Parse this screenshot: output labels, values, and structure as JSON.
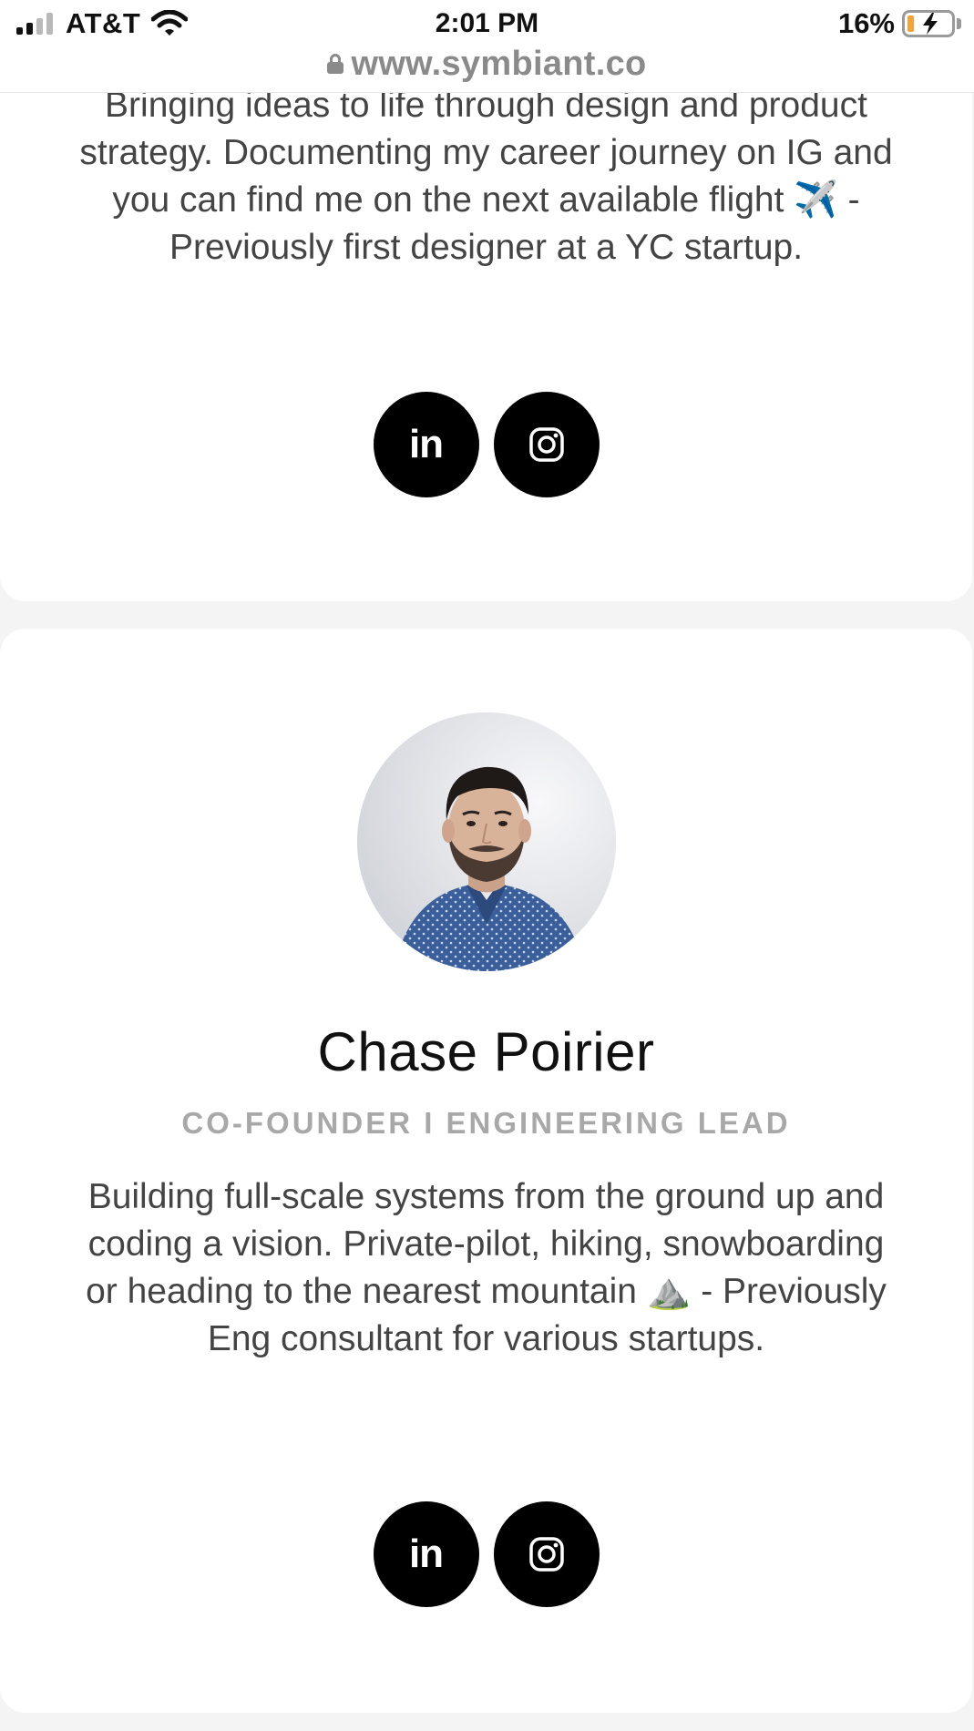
{
  "status_bar": {
    "carrier": "AT&T",
    "time": "2:01 PM",
    "battery_percent": "16%",
    "battery_level": 0.16,
    "url": "www.symbiant.co"
  },
  "profiles": [
    {
      "bio": "Bringing ideas to life through design and product strategy. Documenting my career journey on IG and you can find me on the next available flight ✈️ - Previously first designer at a YC startup.",
      "socials": [
        {
          "icon": "linkedin-icon",
          "label": "in"
        },
        {
          "icon": "instagram-icon"
        }
      ]
    },
    {
      "name": "Chase Poirier",
      "role": "CO-FOUNDER I ENGINEERING LEAD",
      "bio": "Building full-scale systems from the ground up and coding a vision. Private-pilot, hiking, snowboarding or heading to the nearest mountain ⛰️ - Previously Eng consultant for various startups.",
      "socials": [
        {
          "icon": "linkedin-icon",
          "label": "in"
        },
        {
          "icon": "instagram-icon"
        }
      ]
    }
  ]
}
